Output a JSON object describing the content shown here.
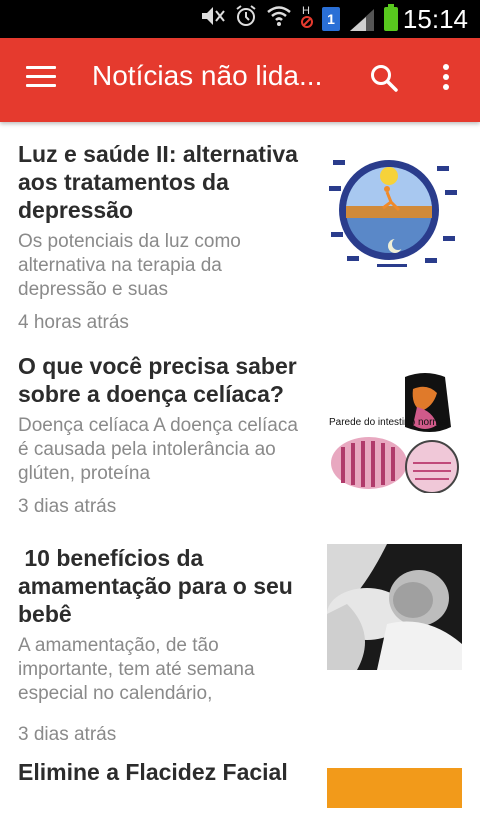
{
  "status_bar": {
    "time": "15:14",
    "sim_label": "1",
    "icons": [
      "mute-icon",
      "alarm-icon",
      "wifi-icon",
      "h-signal-icon",
      "sim-icon",
      "signal-icon",
      "battery-icon"
    ],
    "colors": {
      "battery": "#58c81e",
      "sim": "#2a6fd6"
    }
  },
  "app_bar": {
    "title": "Notícias não lida...",
    "color": "#e53a2e",
    "icons": [
      "menu-icon",
      "search-icon",
      "more-vert-icon"
    ]
  },
  "articles": [
    {
      "title": "Luz e saúde II: alternativa aos tratamentos da depressão",
      "snippet": "Os potenciais da luz como alternativa na terapia da depressão e suas",
      "time": "4 horas atrás",
      "image": "light-health-diagram"
    },
    {
      "title": "O que você precisa saber sobre a doença celíaca?",
      "snippet": "Doença celíaca A doença celíaca é causada pela intolerância ao glúten, proteína",
      "time": "3 dias atrás",
      "image": "celiac-disease-diagram",
      "image_labels": [
        "Parede do intestino normal"
      ]
    },
    {
      "title": " 10 benefícios da amamentação para o seu bebê",
      "snippet": "A amamentação, de tão importante, tem até semana especial no calendário,",
      "time": "3 dias atrás",
      "image": "breastfeeding-photo"
    },
    {
      "title": "Elimine a Flacidez Facial",
      "snippet": "",
      "time": "",
      "image": "course-banner"
    }
  ]
}
